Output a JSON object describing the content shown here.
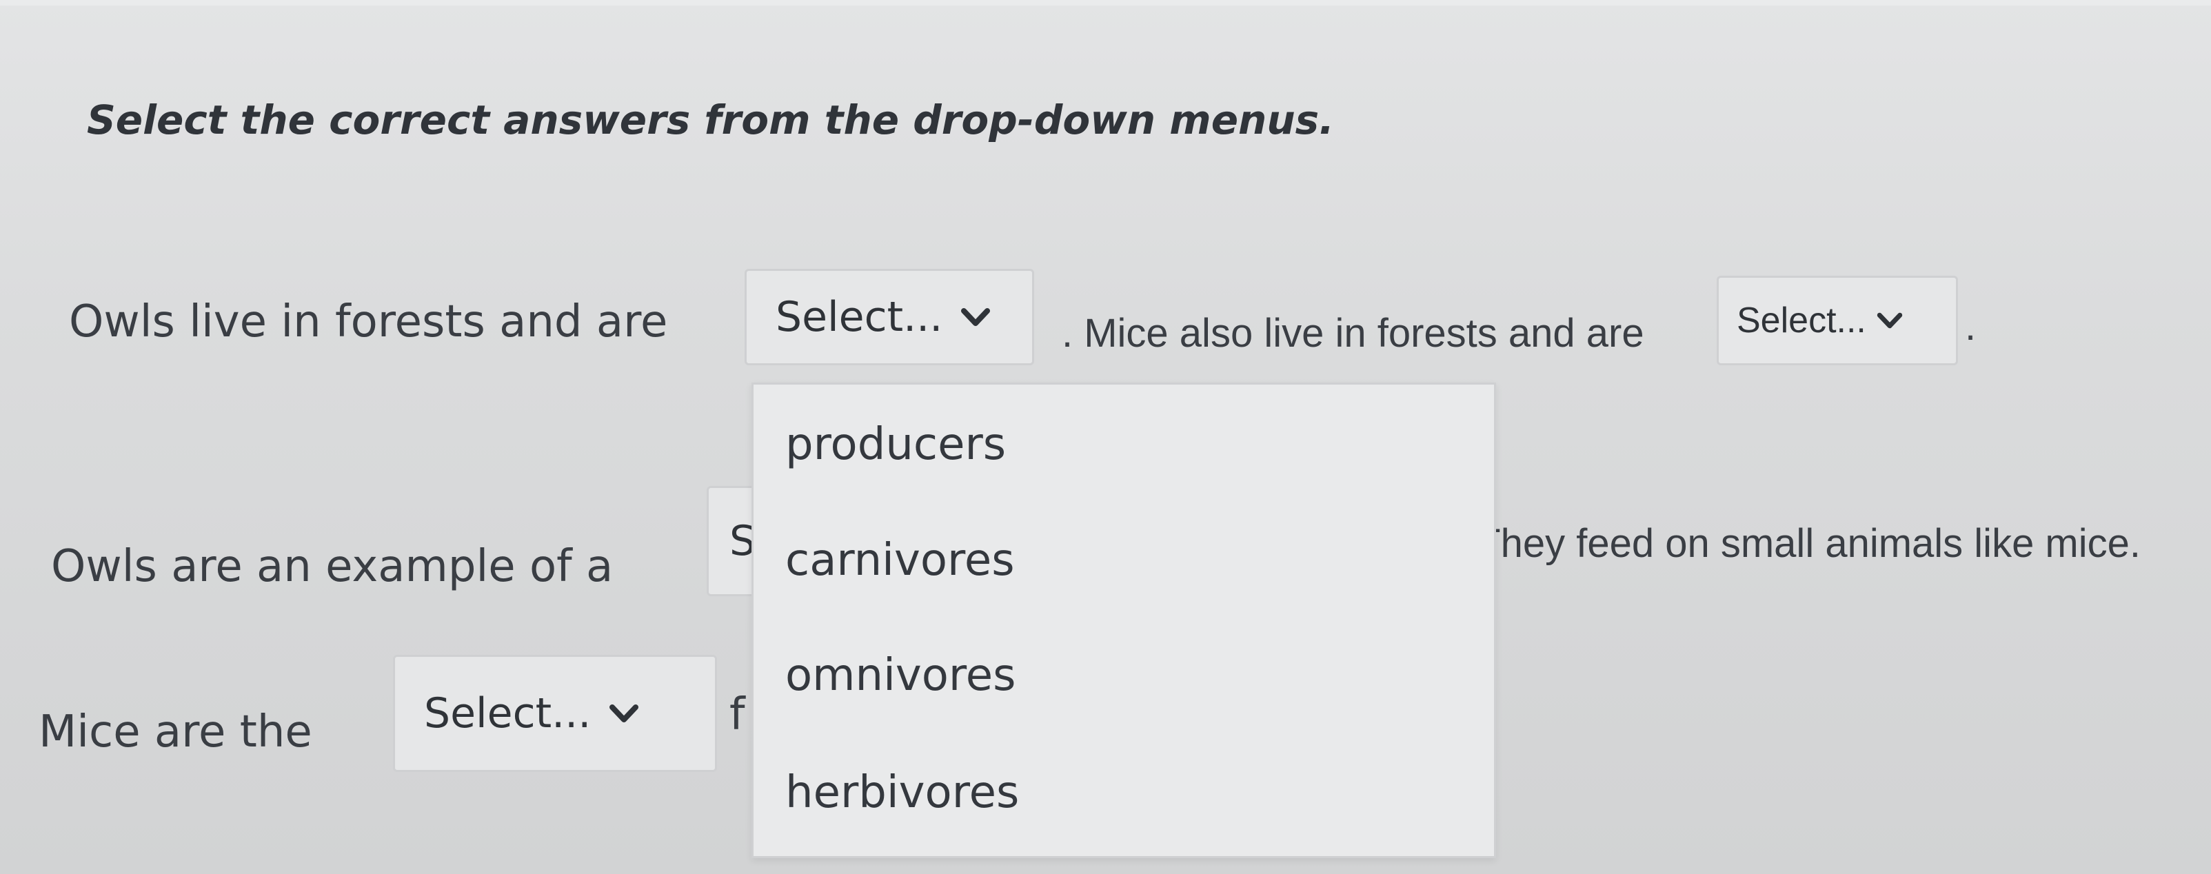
{
  "instruction": "Select the correct answers from the drop-down menus.",
  "sentence1": {
    "part1": "Owls live in forests and are",
    "select1": "Select...",
    "part2": ". Mice also live in forests and are",
    "select2": "Select...",
    "part3": "."
  },
  "sentence2": {
    "part1": "Owls are an example of a",
    "select_partial": "S",
    "part2": ". They feed on small animals like mice."
  },
  "sentence3": {
    "part1": "Mice are the",
    "select": "Select...",
    "part2_partial": "f"
  },
  "dropdown": {
    "options": [
      "producers",
      "carnivores",
      "omnivores",
      "herbivores"
    ]
  }
}
